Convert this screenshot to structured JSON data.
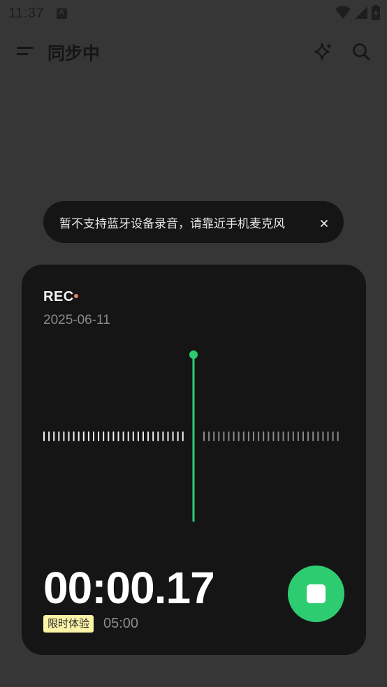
{
  "status_bar": {
    "time": "11:37",
    "icons": [
      "text-a-icon",
      "wifi-icon",
      "signal-icon",
      "battery-icon"
    ]
  },
  "appbar": {
    "title": "同步中",
    "icons": [
      "menu-icon",
      "sparkle-icon",
      "search-icon"
    ]
  },
  "toast": {
    "message": "暂不支持蓝牙设备录音，请靠近手机麦克风"
  },
  "recording": {
    "label": "REC",
    "date": "2025-06-11",
    "elapsed": "00:00.17",
    "trial_badge": "限时体验",
    "limit": "05:00"
  },
  "colors": {
    "background": "#363636",
    "card": "#151515",
    "accent": "#2ecc71",
    "rec_dot": "#e98470",
    "badge": "#fbf3a6"
  }
}
